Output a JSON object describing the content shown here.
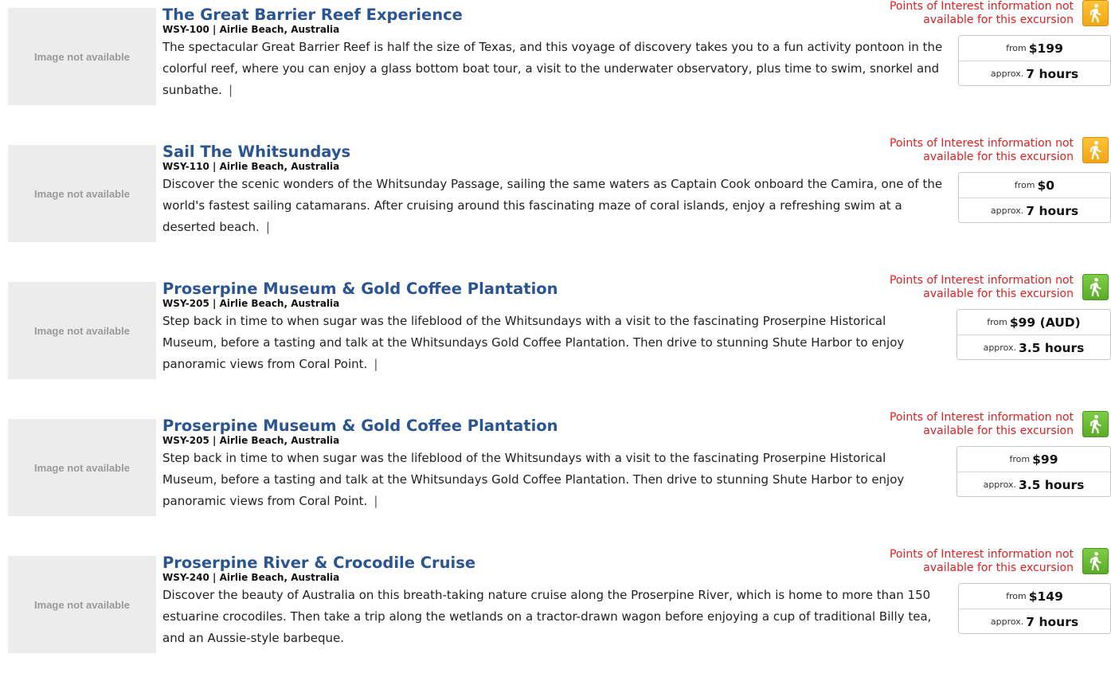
{
  "excursions": [
    {
      "image_placeholder": "Image not available",
      "title": "The Great Barrier Reef Experience",
      "code_location": "WSY-100 | Airlie Beach, Australia",
      "description": "The spectacular Great Barrier Reef is half the size of Texas, and this voyage of discovery takes you to a fun activity pontoon in the colorful reef, where you can enjoy a glass bottom boat tour, a visit to the underwater observatory, plus time to swim, snorkel and sunbathe.",
      "separator": "|",
      "poi_line1": "Points of Interest information not",
      "poi_line2": "available for this excursion",
      "activity_icon": "walking-icon",
      "activity_color": "#f3a511",
      "price_prefix": "from",
      "price": "$199",
      "duration_prefix": "approx.",
      "duration": "7 hours"
    },
    {
      "image_placeholder": "Image not available",
      "title": "Sail The Whitsundays",
      "code_location": "WSY-110 | Airlie Beach, Australia",
      "description": "Discover the scenic wonders of the Whitsunday Passage, sailing the same waters as Captain Cook onboard the Camira, one of the world's fastest sailing catamarans. After cruising around this fascinating maze of coral islands, enjoy a refreshing swim at a deserted beach.",
      "separator": "|",
      "poi_line1": "Points of Interest information not",
      "poi_line2": "available for this excursion",
      "activity_icon": "walking-icon",
      "activity_color": "#f3a511",
      "price_prefix": "from",
      "price": "$0",
      "duration_prefix": "approx.",
      "duration": "7 hours"
    },
    {
      "image_placeholder": "Image not available",
      "title": "Proserpine Museum & Gold Coffee Plantation",
      "code_location": "WSY-205 | Airlie Beach, Australia",
      "description": "Step back in time to when sugar was the lifeblood of the Whitsundays with a visit to the fascinating Proserpine Historical Museum, before a tasting and talk at the Whitsundays Gold Coffee Plantation. Then drive to stunning Shute Harbor to enjoy panoramic views from Coral Point.",
      "separator": "|",
      "poi_line1": "Points of Interest information not",
      "poi_line2": "available for this excursion",
      "activity_icon": "walking-icon",
      "activity_color": "#59ac27",
      "price_prefix": "from",
      "price": "$99 (AUD)",
      "duration_prefix": "approx.",
      "duration": "3.5 hours"
    },
    {
      "image_placeholder": "Image not available",
      "title": "Proserpine Museum & Gold Coffee Plantation",
      "code_location": "WSY-205 | Airlie Beach, Australia",
      "description": "Step back in time to when sugar was the lifeblood of the Whitsundays with a visit to the fascinating Proserpine Historical Museum, before a tasting and talk at the Whitsundays Gold Coffee Plantation. Then drive to stunning Shute Harbor to enjoy panoramic views from Coral Point.",
      "separator": "|",
      "poi_line1": "Points of Interest information not",
      "poi_line2": "available for this excursion",
      "activity_icon": "walking-icon",
      "activity_color": "#59ac27",
      "price_prefix": "from",
      "price": "$99",
      "duration_prefix": "approx.",
      "duration": "3.5 hours"
    },
    {
      "image_placeholder": "Image not available",
      "title": "Proserpine River & Crocodile Cruise",
      "code_location": "WSY-240 | Airlie Beach, Australia",
      "description": "Discover the beauty of Australia on this breath-taking nature cruise along the Proserpine River, which is home to more than 150 estuarine crocodiles. Then take a trip along the wetlands on a tractor-drawn wagon before enjoying a cup of traditional Billy tea, and an Aussie-style barbeque.",
      "separator": "",
      "poi_line1": "Points of Interest information not",
      "poi_line2": "available for this excursion",
      "activity_icon": "walking-icon",
      "activity_color": "#59ac27",
      "price_prefix": "from",
      "price": "$149",
      "duration_prefix": "approx.",
      "duration": "7 hours"
    }
  ]
}
